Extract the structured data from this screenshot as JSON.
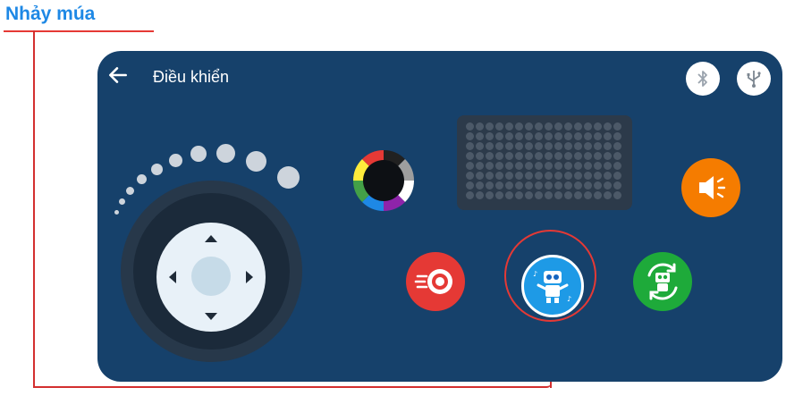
{
  "annotation": {
    "label": "Nhảy múa"
  },
  "header": {
    "title": "Điều khiển"
  },
  "connections": [
    {
      "name": "bluetooth",
      "icon": "bluetooth-icon"
    },
    {
      "name": "usb",
      "icon": "usb-icon"
    }
  ],
  "speed_levels": 9,
  "color_wheel_colors": [
    "#e53935",
    "#ffeb3b",
    "#43a047",
    "#1e88e5",
    "#8e24aa",
    "#ffffff",
    "#9e9e9e",
    "#212121"
  ],
  "actions": [
    {
      "name": "speed",
      "icon": "speedometer-icon",
      "color": "#e53935"
    },
    {
      "name": "dance",
      "icon": "dancing-robot-icon",
      "color": "#1e9ae6",
      "selected": true
    },
    {
      "name": "auto",
      "icon": "rotating-robot-icon",
      "color": "#1eaa3a"
    },
    {
      "name": "sound",
      "icon": "speaker-icon",
      "color": "#f57c00"
    }
  ],
  "colors": {
    "panel": "#16416b",
    "annotation": "#1e88e5",
    "highlight": "#e53935"
  }
}
